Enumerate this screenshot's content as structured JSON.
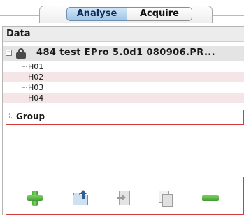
{
  "tabs": [
    {
      "label": "Analyse",
      "selected": true
    },
    {
      "label": "Acquire",
      "selected": false
    }
  ],
  "panel": {
    "header": "Data",
    "tree": {
      "file": {
        "expander": "−",
        "name": "484 test EPro 5.0d1 080906.PR...",
        "locked": true,
        "children": [
          "H01",
          "H02",
          "H03",
          "H04"
        ]
      },
      "group_label": "Group"
    }
  },
  "toolbar": {
    "icons": [
      "add-icon",
      "export-folder-icon",
      "import-document-icon",
      "duplicate-icon",
      "remove-icon"
    ]
  },
  "colors": {
    "highlight_box": "#d33a3a",
    "tab_selected": "#9fc5e8",
    "alt_row": "#f4e6e6",
    "icon_green": "#4fae3d"
  }
}
